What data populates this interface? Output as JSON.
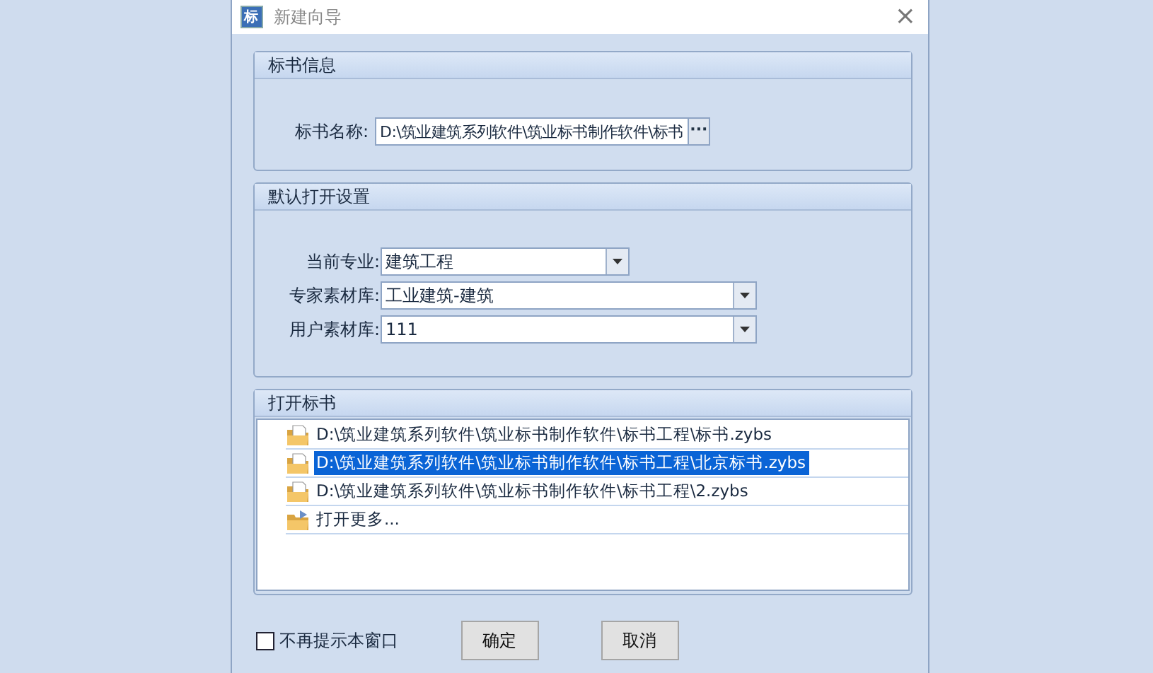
{
  "window": {
    "icon_text": "标",
    "title": "新建向导",
    "close": "×"
  },
  "info_group": {
    "title": "标书信息",
    "label": "标书名称:",
    "value": "D:\\筑业建筑系列软件\\筑业标书制作软件\\标书",
    "browse": "···"
  },
  "defaults_group": {
    "title": "默认打开设置",
    "fields": [
      {
        "label": "当前专业:",
        "value": "建筑工程"
      },
      {
        "label": "专家素材库:",
        "value": "工业建筑-建筑"
      },
      {
        "label": "用户素材库:",
        "value": "111"
      }
    ]
  },
  "open_group": {
    "title": "打开标书",
    "items": [
      {
        "kind": "file",
        "text": "D:\\筑业建筑系列软件\\筑业标书制作软件\\标书工程\\标书.zybs",
        "selected": false
      },
      {
        "kind": "file",
        "text": "D:\\筑业建筑系列软件\\筑业标书制作软件\\标书工程\\北京标书.zybs",
        "selected": true
      },
      {
        "kind": "file",
        "text": "D:\\筑业建筑系列软件\\筑业标书制作软件\\标书工程\\2.zybs",
        "selected": false
      },
      {
        "kind": "more",
        "text": "打开更多...",
        "selected": false
      }
    ]
  },
  "footer": {
    "checkbox": {
      "label": "不再提示本窗口",
      "checked": false
    },
    "buttons": [
      "确定",
      "取消"
    ]
  }
}
